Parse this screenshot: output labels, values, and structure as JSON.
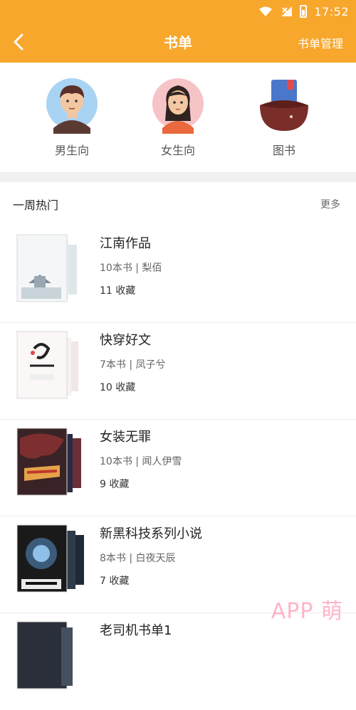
{
  "status_bar": {
    "time": "17:52",
    "icons": [
      "wifi-icon",
      "signal-icon",
      "battery-icon"
    ]
  },
  "app_bar": {
    "title": "书单",
    "right_action": "书单管理"
  },
  "categories": [
    {
      "label": "男生向",
      "icon": "male-avatar-icon"
    },
    {
      "label": "女生向",
      "icon": "female-avatar-icon"
    },
    {
      "label": "图书",
      "icon": "book-icon"
    }
  ],
  "weekly_hot": {
    "title": "一周热门",
    "more": "更多",
    "items": [
      {
        "name": "江南作品",
        "meta": "10本书 | 梨佰",
        "favs": "11 收藏"
      },
      {
        "name": "快穿好文",
        "meta": "7本书 | 凤子兮",
        "favs": "10 收藏"
      },
      {
        "name": "女装无罪",
        "meta": "10本书 | 闻人伊雪",
        "favs": "9 收藏"
      },
      {
        "name": "新黑科技系列小说",
        "meta": "8本书 | 白夜天辰",
        "favs": "7 收藏"
      },
      {
        "name": "老司机书单1",
        "meta": "",
        "favs": ""
      }
    ]
  },
  "watermark": "APP 萌",
  "colors": {
    "accent": "#f7a72c",
    "divider": "#f1f1f1"
  }
}
